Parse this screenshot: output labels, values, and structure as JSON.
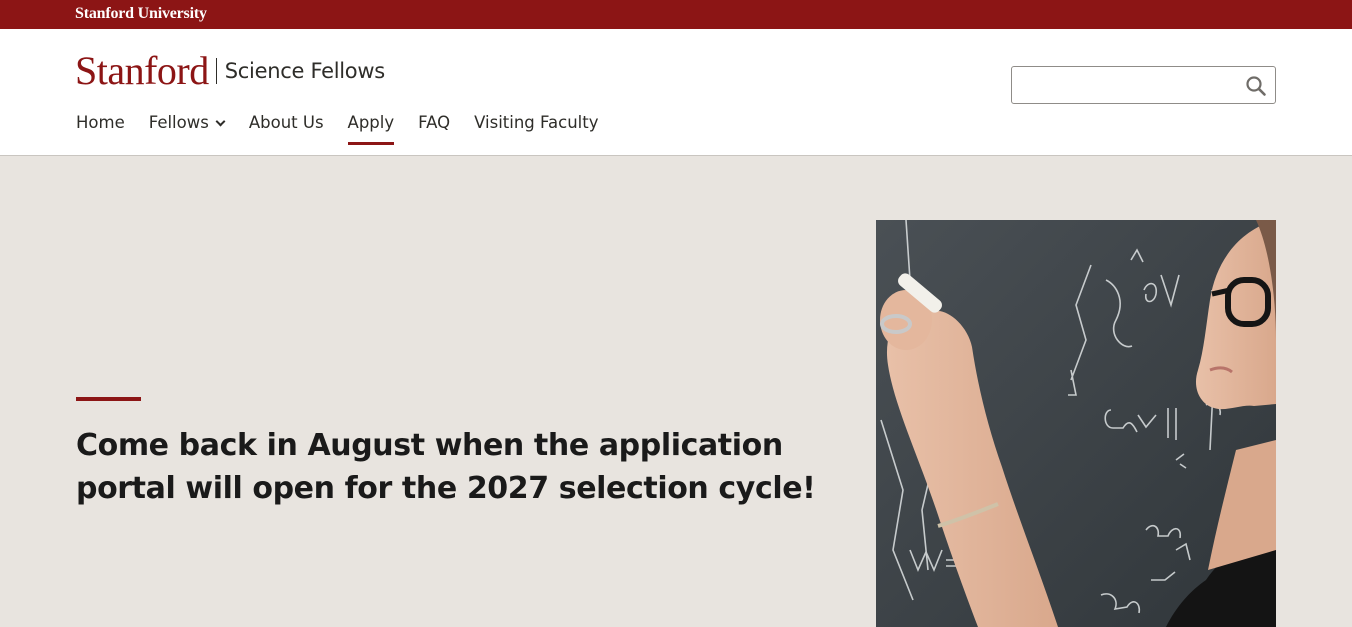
{
  "topbar": {
    "university": "Stanford University"
  },
  "brand": {
    "wordmark": "Stanford",
    "site_name": "Science Fellows"
  },
  "nav": {
    "items": [
      {
        "label": "Home",
        "active": false
      },
      {
        "label": "Fellows",
        "active": false,
        "has_dropdown": true
      },
      {
        "label": "About Us",
        "active": false
      },
      {
        "label": "Apply",
        "active": true
      },
      {
        "label": "FAQ",
        "active": false
      },
      {
        "label": "Visiting Faculty",
        "active": false
      }
    ]
  },
  "search": {
    "value": "",
    "placeholder": "",
    "icon": "search-icon"
  },
  "hero": {
    "headline": "Come back in August when the application portal will open for the 2027 selection cycle!",
    "image_icon": "photo-woman-writing-on-chalkboard"
  },
  "colors": {
    "brand_red": "#8c1515",
    "hero_bg": "#e8e4df",
    "text_dark": "#2e2d29",
    "chalkboard": "#3a4044"
  }
}
